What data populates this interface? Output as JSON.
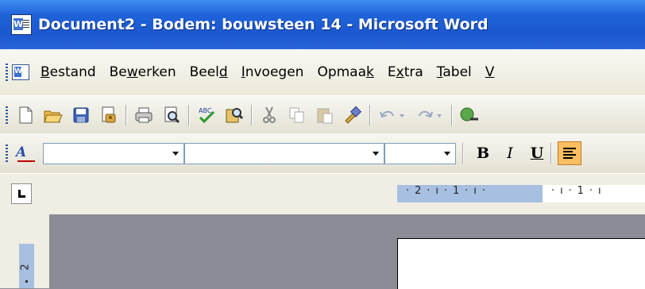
{
  "window": {
    "title": "Document2 - Bodem: bouwsteen  14 - Microsoft Word",
    "app_icon": "word-document-icon"
  },
  "menubar": {
    "items": [
      {
        "pre": "",
        "key": "B",
        "post": "estand"
      },
      {
        "pre": "Be",
        "key": "w",
        "post": "erken"
      },
      {
        "pre": "Beel",
        "key": "d",
        "post": ""
      },
      {
        "pre": "",
        "key": "I",
        "post": "nvoegen"
      },
      {
        "pre": "Opmaa",
        "key": "k",
        "post": ""
      },
      {
        "pre": "E",
        "key": "x",
        "post": "tra"
      },
      {
        "pre": "",
        "key": "T",
        "post": "abel"
      },
      {
        "pre": "",
        "key": "V",
        "post": ""
      }
    ]
  },
  "standard_toolbar": {
    "buttons": [
      "new-document-icon",
      "open-folder-icon",
      "save-icon",
      "permission-icon",
      "print-icon",
      "print-preview-icon",
      "spelling-icon",
      "research-icon",
      "cut-icon",
      "copy-icon",
      "paste-icon",
      "format-painter-icon",
      "undo-icon",
      "redo-icon",
      "hyperlink-icon"
    ]
  },
  "formatting_toolbar": {
    "style_icon_label": "A",
    "style_value": "",
    "font_value": "",
    "size_value": "",
    "bold_label": "B",
    "italic_label": "I",
    "underline_label": "U"
  },
  "ruler": {
    "left_text": "· 2 · ı · 1 · ı ·",
    "right_text": "· ı · 1 · ı"
  },
  "vertical_ruler": {
    "label": "2"
  },
  "colors": {
    "title_blue": "#2359d5",
    "align_active": "#ffbf61",
    "ruler_margin": "#a7bfe0"
  }
}
